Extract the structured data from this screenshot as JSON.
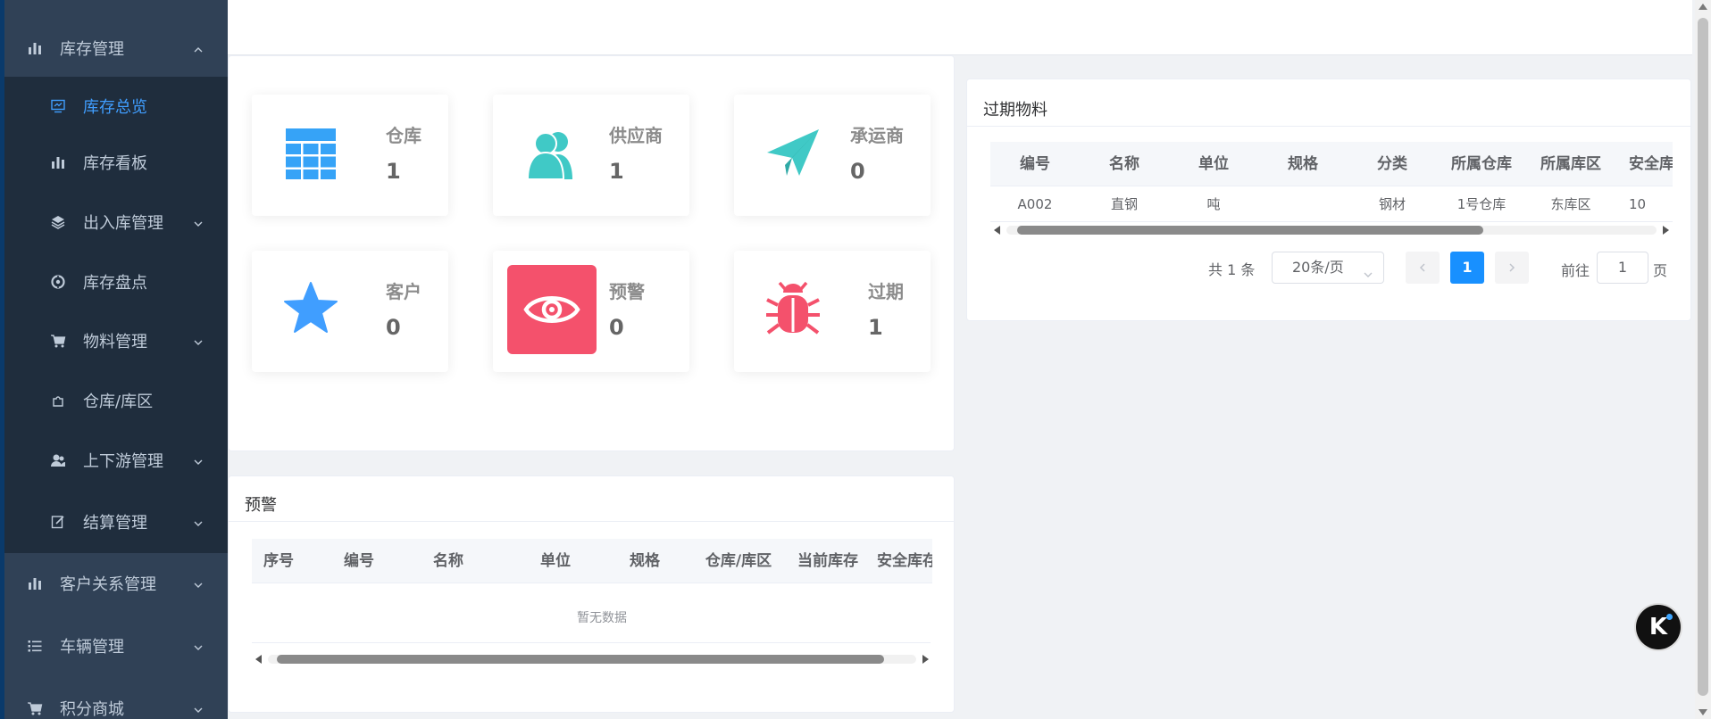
{
  "sidebar": {
    "top_items": [
      {
        "label": "库存管理",
        "icon": "bar-chart-icon"
      },
      {
        "label": "客户关系管理",
        "icon": "bar-chart-icon"
      },
      {
        "label": "车辆管理",
        "icon": "list-icon"
      },
      {
        "label": "积分商城",
        "icon": "cart-icon"
      }
    ],
    "sub_items": [
      {
        "label": "库存总览",
        "icon": "monitor-icon",
        "active": true
      },
      {
        "label": "库存看板",
        "icon": "bar-chart-icon"
      },
      {
        "label": "出入库管理",
        "icon": "layers-icon"
      },
      {
        "label": "库存盘点",
        "icon": "aperture-icon"
      },
      {
        "label": "物料管理",
        "icon": "cart-icon"
      },
      {
        "label": "仓库/库区",
        "icon": "puzzle-icon"
      },
      {
        "label": "上下游管理",
        "icon": "users-icon"
      },
      {
        "label": "结算管理",
        "icon": "edit-icon"
      }
    ],
    "colors": {
      "bg": "#304156",
      "submenu_bg": "#1f2d3d",
      "text": "#bfcbd9",
      "active": "#409eff"
    }
  },
  "stats": [
    {
      "label": "仓库",
      "count": "1",
      "icon": "table-grid-icon",
      "color": "#36a3f7"
    },
    {
      "label": "供应商",
      "count": "1",
      "icon": "people-icon",
      "color": "#40c9c6"
    },
    {
      "label": "承运商",
      "count": "0",
      "icon": "paper-plane-icon",
      "color": "#40c9c6"
    },
    {
      "label": "客户",
      "count": "0",
      "icon": "star-icon",
      "color": "#409eff"
    },
    {
      "label": "预警",
      "count": "0",
      "icon": "eye-icon",
      "color": "#f4516c"
    },
    {
      "label": "过期",
      "count": "1",
      "icon": "bug-icon",
      "color": "#f4516c"
    }
  ],
  "expired": {
    "title": "过期物料",
    "columns": [
      "编号",
      "名称",
      "单位",
      "规格",
      "分类",
      "所属仓库",
      "所属库区",
      "安全库存"
    ],
    "rows": [
      [
        "A002",
        "直钢",
        "吨",
        "",
        "钢材",
        "1号仓库",
        "东库区",
        "10"
      ]
    ],
    "pagination": {
      "total": "共 1 条",
      "page_size": "20条/页",
      "current": "1",
      "goto_label": "前往",
      "goto_value": "1",
      "page_suffix": "页"
    }
  },
  "warning": {
    "title": "预警",
    "columns": [
      "序号",
      "编号",
      "名称",
      "单位",
      "规格",
      "仓库/库区",
      "当前库存",
      "安全库存"
    ],
    "empty_text": "暂无数据"
  },
  "floating_button": {
    "label": "K"
  }
}
